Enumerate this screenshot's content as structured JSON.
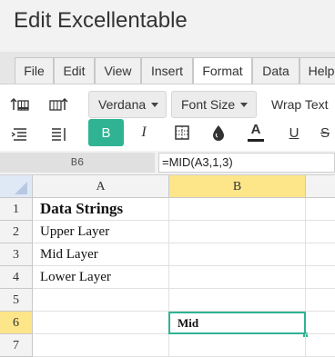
{
  "app": {
    "title": "Edit Excellentable"
  },
  "menu": {
    "tabs": [
      "File",
      "Edit",
      "View",
      "Insert",
      "Format",
      "Data",
      "Help"
    ],
    "active": "Format"
  },
  "toolbar": {
    "font_family": "Verdana",
    "font_size": "Font Size",
    "wrap_text": "Wrap Text",
    "bold": "B",
    "italic": "I",
    "font_color": "A",
    "underline": "U",
    "strikethrough": "S",
    "accent_color": "#2fb393"
  },
  "formula_bar": {
    "cell_ref": "B6",
    "formula": "=MID(A3,1,3)"
  },
  "grid": {
    "columns": [
      "A",
      "B"
    ],
    "rows": [
      "1",
      "2",
      "3",
      "4",
      "5",
      "6",
      "7"
    ],
    "cells": {
      "A1": "Data Strings",
      "A2": "Upper Layer",
      "A3": "Mid Layer",
      "A4": "Lower Layer",
      "B6": "Mid"
    },
    "selected_cell": "B6",
    "selection_color": "#2fb393",
    "header_highlight_color": "#fde58a"
  }
}
